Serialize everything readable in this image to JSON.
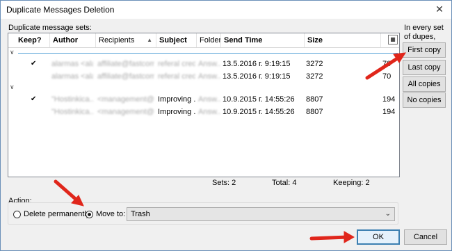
{
  "window": {
    "title": "Duplicate Messages Deletion"
  },
  "grid": {
    "label": "Duplicate message sets:",
    "columns": [
      "Keep?",
      "Author",
      "Recipients",
      "Subject",
      "Folder",
      "Send Time",
      "Size"
    ],
    "rows": [
      {
        "keep": "✔",
        "author": "alarmas <alar...",
        "recipients": "affiliate@fastcom...",
        "subject": "referal credit",
        "folder": "Answ...",
        "send_time": "13.5.2016 г. 9:19:15",
        "size": "3272",
        "extra": "70"
      },
      {
        "keep": "",
        "author": "alarmas <alar...",
        "recipients": "affiliate@fastcom...",
        "subject": "referal credit",
        "folder": "Answ...",
        "send_time": "13.5.2016 г. 9:19:15",
        "size": "3272",
        "extra": "70"
      },
      {
        "keep": "✔",
        "author": "\"Hostinkica...",
        "recipients": "<management@f...",
        "subject": "Improving ...",
        "folder": "Answ...",
        "send_time": "10.9.2015 г. 14:55:26",
        "size": "8807",
        "extra": "194"
      },
      {
        "keep": "",
        "author": "\"Hostinkica...",
        "recipients": "<management@f...",
        "subject": "Improving ...",
        "folder": "Answ...",
        "send_time": "10.9.2015 г. 14:55:26",
        "size": "8807",
        "extra": "194"
      }
    ]
  },
  "status": {
    "sets": "Sets: 2",
    "total": "Total: 4",
    "keeping": "Keeping: 2"
  },
  "action": {
    "label": "Action:",
    "delete_label": "Delete permanently",
    "move_label": "Move to:",
    "target": "Trash"
  },
  "keep_panel": {
    "label": "In every set of dupes, keep:",
    "first": "First copy",
    "last": "Last copy",
    "all": "All copies",
    "none": "No copies"
  },
  "buttons": {
    "ok": "OK",
    "cancel": "Cancel"
  },
  "colors": {
    "accent": "#3c7fb1",
    "annotation": "#e0261b"
  }
}
